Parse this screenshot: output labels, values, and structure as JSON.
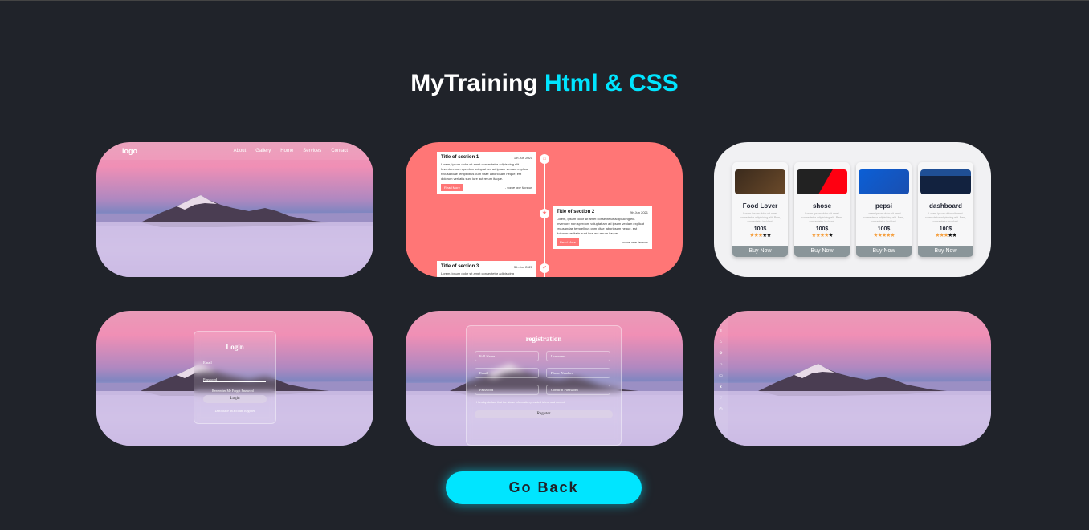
{
  "title": {
    "main": "MyTraining",
    "accent": "Html & CSS"
  },
  "landing": {
    "logo": "logo",
    "links": [
      "About",
      "Gallery",
      "Home",
      "Services",
      "Contact"
    ]
  },
  "timeline": {
    "sections": [
      {
        "title": "Title of section 1",
        "date": "1th Jun 2021",
        "text": "Lorem, ipsum dolor sit amet consectetur adipisicing elit. Inventore non sperdom voluptat am ad ipsam veniam explicat recusandae tempellbus cum vitae laboriosam neque, est dolorum veritatis sunt iure aut rerum itaque.",
        "button": "Read More",
        "author": "- some one famous"
      },
      {
        "title": "Title of section 2",
        "date": "2th Jun 2021",
        "text": "Lorem, ipsum dolor sit amet consectetur adipisicing elit. Inventore non sperdom voluptat am ad ipsam veniam explicat recusandae tempellbus cum vitae laboriosam neque, est dolorum veritatis sunt iure aut rerum itaque.",
        "button": "Read More",
        "author": "- some one famous"
      },
      {
        "title": "Title of section 3",
        "date": "3th Jun 2021",
        "text": "Lorem, ipsum dolor sit amet consectetur adipisicing",
        "button": "",
        "author": ""
      }
    ]
  },
  "products": [
    {
      "name": "Food Lover",
      "desc": "Lorem ipsum dolor sit amet consectetur adipisicing elit. Rem, consectetur incidunt.",
      "price": "100$",
      "stars": 3,
      "button": "Buy Now"
    },
    {
      "name": "shose",
      "desc": "Lorem ipsum dolor sit amet consectetur adipisicing elit. Rem, consectetur incidunt.",
      "price": "100$",
      "stars": 4,
      "button": "Buy Now"
    },
    {
      "name": "pepsi",
      "desc": "Lorem ipsum dolor sit amet consectetur adipisicing elit. Rem, consectetur incidunt.",
      "price": "100$",
      "stars": 5,
      "button": "Buy Now"
    },
    {
      "name": "dashboard",
      "desc": "Lorem ipsum dolor sit amet consectetur adipisicing elit. Rem, consectetur incidunt.",
      "price": "100$",
      "stars": 3,
      "button": "Buy Now"
    }
  ],
  "login": {
    "title": "Login",
    "email": "Email",
    "password": "Password",
    "remember": "Remember Me  Forgot Password",
    "button": "Login",
    "register": "Don't have an account Register"
  },
  "registration": {
    "title": "registration",
    "fields": [
      "Full Name",
      "Username",
      "Email",
      "Phone Number",
      "Password",
      "Confirm Password"
    ],
    "declare": "I hereby declare that the above information provided is true and correct.",
    "button": "Register"
  },
  "go_back": "Go Back",
  "colors": {
    "accent": "#00e5ff",
    "timeline": "#ff7676",
    "star": "#f5a142"
  }
}
